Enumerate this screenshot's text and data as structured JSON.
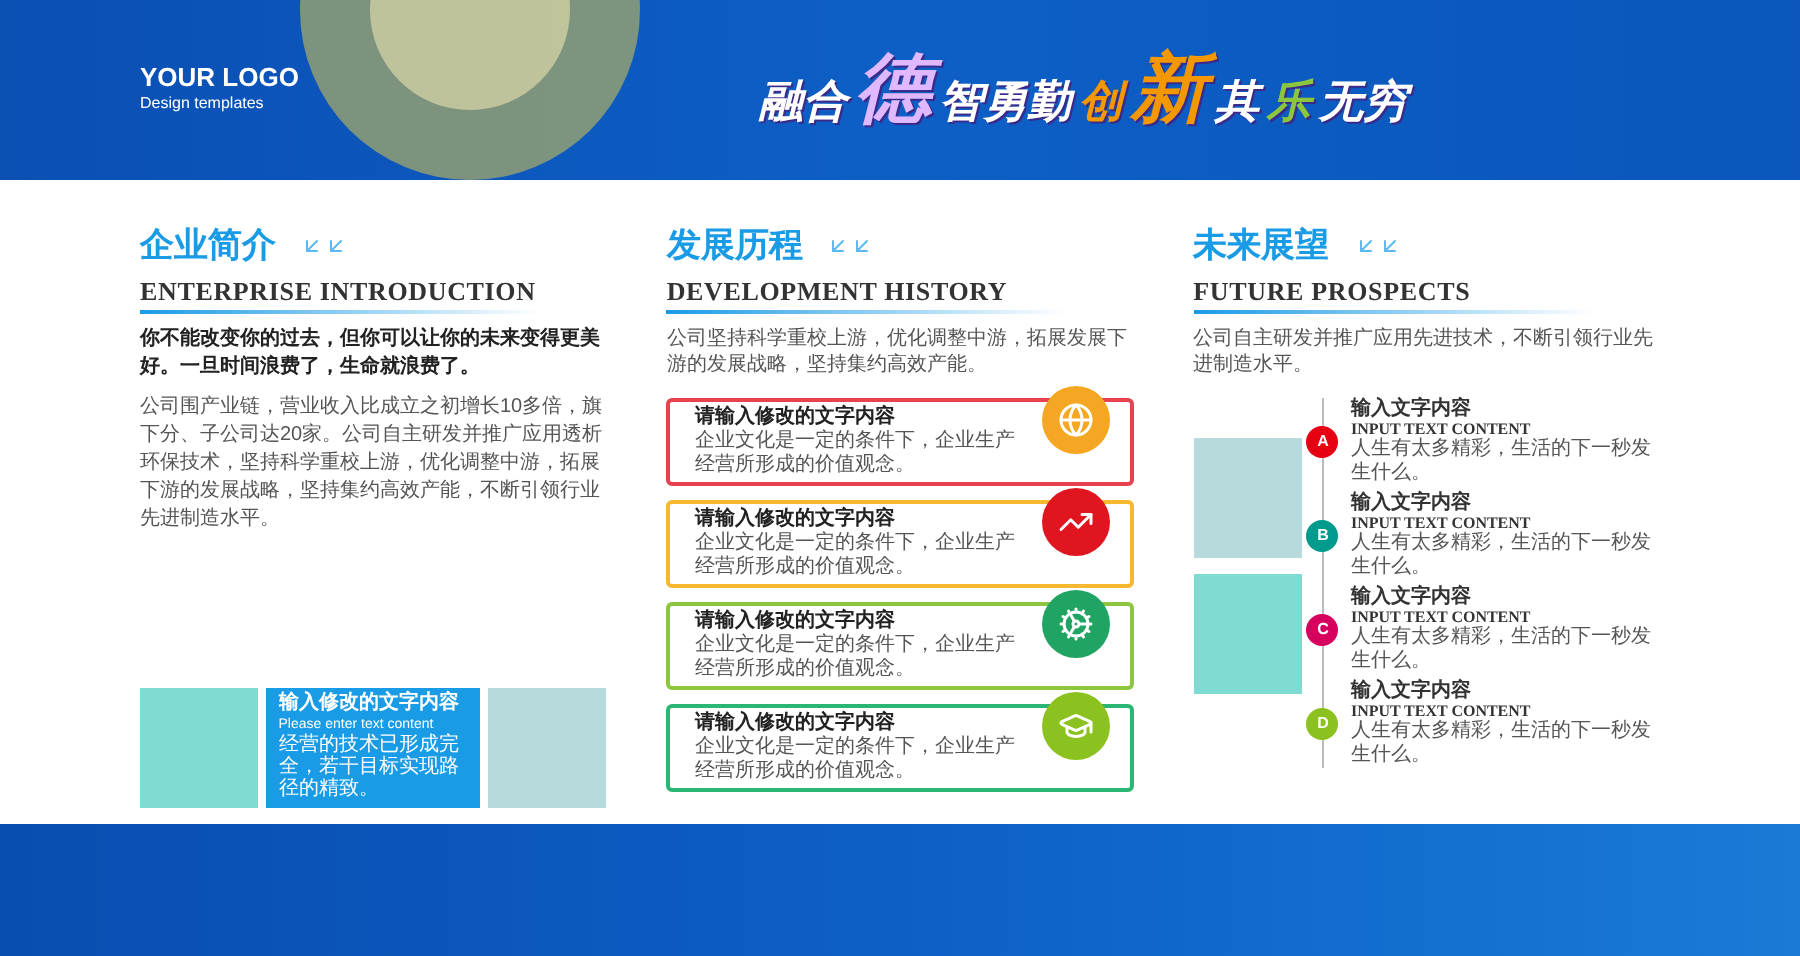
{
  "header": {
    "logo": "YOUR LOGO",
    "logo_subtitle": "Design templates",
    "slogan": [
      {
        "text": "融合",
        "large": false,
        "color": "#ffffff"
      },
      {
        "text": "德",
        "large": true,
        "color": "#dfb8ff"
      },
      {
        "text": "智勇勤",
        "large": false,
        "color": "#ffffff"
      },
      {
        "text": "创",
        "large": false,
        "color": "#f39800"
      },
      {
        "text": "新",
        "large": true,
        "color": "#f39800"
      },
      {
        "text": "其",
        "large": false,
        "color": "#ffffff"
      },
      {
        "text": "乐",
        "large": false,
        "color": "#8cc63f"
      },
      {
        "text": "无穷",
        "large": false,
        "color": "#ffffff"
      }
    ]
  },
  "sections": [
    {
      "kind": "intro",
      "title": "企业简介",
      "subtitle": "ENTERPRISE INTRODUCTION",
      "quote": "你不能改变你的过去，但你可以让你的未来变得更美好。一旦时间浪费了，生命就浪费了。",
      "paragraph": "公司围产业链，营业收入比成立之初增长10多倍，旗下分、子公司达20家。公司自主研发并推广应用透析环保技术，坚持科学重校上游，优化调整中游，拓展下游的发展战略，坚持集约高效产能，不断引领行业先进制造水平。",
      "boxes": [
        {
          "kind": "plain",
          "color": "#7fdcd2"
        },
        {
          "kind": "text",
          "color": "#1a9be6",
          "title": "输入修改的文字内容",
          "subtitle": "Please enter text content",
          "text": "经营的技术已形成完全，若干目标实现路径的精致。"
        },
        {
          "kind": "plain",
          "color": "#b7dbdc"
        }
      ]
    },
    {
      "kind": "history",
      "title": "发展历程",
      "subtitle": "DEVELOPMENT HISTORY",
      "paragraph": "公司坚持科学重校上游，优化调整中游，拓展发展下游的发展战略，坚持集约高效产能。",
      "cards": [
        {
          "title": "请输入修改的文字内容",
          "text": "企业文化是一定的条件下，企业生产经营所形成的价值观念。",
          "color": "#e8414f"
        },
        {
          "title": "请输入修改的文字内容",
          "text": "企业文化是一定的条件下，企业生产经营所形成的价值观念。",
          "color": "#f5b82e"
        },
        {
          "title": "请输入修改的文字内容",
          "text": "企业文化是一定的条件下，企业生产经营所形成的价值观念。",
          "color": "#8cc63f"
        },
        {
          "title": "请输入修改的文字内容",
          "text": "企业文化是一定的条件下，企业生产经营所形成的价值观念。",
          "color": "#2bb673"
        }
      ]
    },
    {
      "kind": "future",
      "title": "未来展望",
      "subtitle": "FUTURE PROSPECTS",
      "paragraph": "公司自主研发并推广应用先进技术，不断引领行业先进制造水平。",
      "items": [
        {
          "letter": "A",
          "color": "#e60012",
          "title": "输入文字内容",
          "subtitle": "INPUT TEXT CONTENT",
          "text": "人生有太多精彩，生活的下一秒发生什么。"
        },
        {
          "letter": "B",
          "color": "#009b8d",
          "title": "输入文字内容",
          "subtitle": "INPUT TEXT CONTENT",
          "text": "人生有太多精彩，生活的下一秒发生什么。"
        },
        {
          "letter": "C",
          "color": "#d6005f",
          "title": "输入文字内容",
          "subtitle": "INPUT TEXT CONTENT",
          "text": "人生有太多精彩，生活的下一秒发生什么。"
        },
        {
          "letter": "D",
          "color": "#8cc21f",
          "title": "输入文字内容",
          "subtitle": "INPUT TEXT CONTENT",
          "text": "人生有太多精彩，生活的下一秒发生什么。"
        }
      ]
    }
  ]
}
